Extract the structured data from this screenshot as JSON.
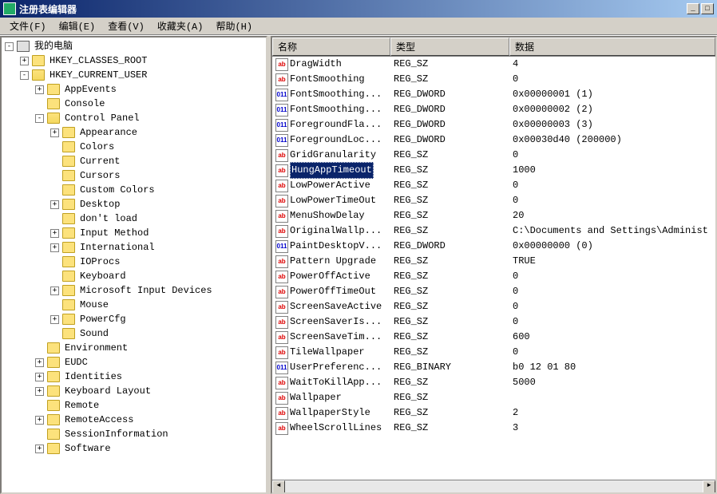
{
  "window_title": "注册表编辑器",
  "menu": {
    "file": "文件(F)",
    "edit": "编辑(E)",
    "view": "查看(V)",
    "favorites": "收藏夹(A)",
    "help": "帮助(H)"
  },
  "columns": {
    "name": "名称",
    "type": "类型",
    "data": "数据"
  },
  "tree": [
    {
      "indent": 0,
      "exp": "-",
      "icon": "computer",
      "label": "我的电脑"
    },
    {
      "indent": 1,
      "exp": "+",
      "icon": "folder",
      "label": "HKEY_CLASSES_ROOT"
    },
    {
      "indent": 1,
      "exp": "-",
      "icon": "folder-open",
      "label": "HKEY_CURRENT_USER"
    },
    {
      "indent": 2,
      "exp": "+",
      "icon": "folder",
      "label": "AppEvents"
    },
    {
      "indent": 2,
      "exp": "",
      "icon": "folder",
      "label": "Console"
    },
    {
      "indent": 2,
      "exp": "-",
      "icon": "folder-open",
      "label": "Control Panel"
    },
    {
      "indent": 3,
      "exp": "+",
      "icon": "folder",
      "label": "Appearance"
    },
    {
      "indent": 3,
      "exp": "",
      "icon": "folder",
      "label": "Colors"
    },
    {
      "indent": 3,
      "exp": "",
      "icon": "folder",
      "label": "Current"
    },
    {
      "indent": 3,
      "exp": "",
      "icon": "folder",
      "label": "Cursors"
    },
    {
      "indent": 3,
      "exp": "",
      "icon": "folder",
      "label": "Custom Colors"
    },
    {
      "indent": 3,
      "exp": "+",
      "icon": "folder",
      "label": "Desktop"
    },
    {
      "indent": 3,
      "exp": "",
      "icon": "folder",
      "label": "don't load"
    },
    {
      "indent": 3,
      "exp": "+",
      "icon": "folder",
      "label": "Input Method"
    },
    {
      "indent": 3,
      "exp": "+",
      "icon": "folder",
      "label": "International"
    },
    {
      "indent": 3,
      "exp": "",
      "icon": "folder",
      "label": "IOProcs"
    },
    {
      "indent": 3,
      "exp": "",
      "icon": "folder",
      "label": "Keyboard"
    },
    {
      "indent": 3,
      "exp": "+",
      "icon": "folder",
      "label": "Microsoft Input Devices"
    },
    {
      "indent": 3,
      "exp": "",
      "icon": "folder",
      "label": "Mouse"
    },
    {
      "indent": 3,
      "exp": "+",
      "icon": "folder",
      "label": "PowerCfg"
    },
    {
      "indent": 3,
      "exp": "",
      "icon": "folder",
      "label": "Sound"
    },
    {
      "indent": 2,
      "exp": "",
      "icon": "folder",
      "label": "Environment"
    },
    {
      "indent": 2,
      "exp": "+",
      "icon": "folder",
      "label": "EUDC"
    },
    {
      "indent": 2,
      "exp": "+",
      "icon": "folder",
      "label": "Identities"
    },
    {
      "indent": 2,
      "exp": "+",
      "icon": "folder",
      "label": "Keyboard Layout"
    },
    {
      "indent": 2,
      "exp": "",
      "icon": "folder",
      "label": "Remote"
    },
    {
      "indent": 2,
      "exp": "+",
      "icon": "folder",
      "label": "RemoteAccess"
    },
    {
      "indent": 2,
      "exp": "",
      "icon": "folder",
      "label": "SessionInformation"
    },
    {
      "indent": 2,
      "exp": "+",
      "icon": "folder",
      "label": "Software"
    }
  ],
  "values": [
    {
      "icon": "sz",
      "name": "DragWidth",
      "type": "REG_SZ",
      "data": "4",
      "selected": false
    },
    {
      "icon": "sz",
      "name": "FontSmoothing",
      "type": "REG_SZ",
      "data": "0",
      "selected": false
    },
    {
      "icon": "dw",
      "name": "FontSmoothing...",
      "type": "REG_DWORD",
      "data": "0x00000001 (1)",
      "selected": false
    },
    {
      "icon": "dw",
      "name": "FontSmoothing...",
      "type": "REG_DWORD",
      "data": "0x00000002 (2)",
      "selected": false
    },
    {
      "icon": "dw",
      "name": "ForegroundFla...",
      "type": "REG_DWORD",
      "data": "0x00000003 (3)",
      "selected": false
    },
    {
      "icon": "dw",
      "name": "ForegroundLoc...",
      "type": "REG_DWORD",
      "data": "0x00030d40 (200000)",
      "selected": false
    },
    {
      "icon": "sz",
      "name": "GridGranularity",
      "type": "REG_SZ",
      "data": "0",
      "selected": false
    },
    {
      "icon": "sz",
      "name": "HungAppTimeout",
      "type": "REG_SZ",
      "data": "1000",
      "selected": true
    },
    {
      "icon": "sz",
      "name": "LowPowerActive",
      "type": "REG_SZ",
      "data": "0",
      "selected": false
    },
    {
      "icon": "sz",
      "name": "LowPowerTimeOut",
      "type": "REG_SZ",
      "data": "0",
      "selected": false
    },
    {
      "icon": "sz",
      "name": "MenuShowDelay",
      "type": "REG_SZ",
      "data": "20",
      "selected": false
    },
    {
      "icon": "sz",
      "name": "OriginalWallp...",
      "type": "REG_SZ",
      "data": "C:\\Documents and Settings\\Administ",
      "selected": false
    },
    {
      "icon": "dw",
      "name": "PaintDesktopV...",
      "type": "REG_DWORD",
      "data": "0x00000000 (0)",
      "selected": false
    },
    {
      "icon": "sz",
      "name": "Pattern Upgrade",
      "type": "REG_SZ",
      "data": "TRUE",
      "selected": false
    },
    {
      "icon": "sz",
      "name": "PowerOffActive",
      "type": "REG_SZ",
      "data": "0",
      "selected": false
    },
    {
      "icon": "sz",
      "name": "PowerOffTimeOut",
      "type": "REG_SZ",
      "data": "0",
      "selected": false
    },
    {
      "icon": "sz",
      "name": "ScreenSaveActive",
      "type": "REG_SZ",
      "data": "0",
      "selected": false
    },
    {
      "icon": "sz",
      "name": "ScreenSaverIs...",
      "type": "REG_SZ",
      "data": "0",
      "selected": false
    },
    {
      "icon": "sz",
      "name": "ScreenSaveTim...",
      "type": "REG_SZ",
      "data": "600",
      "selected": false
    },
    {
      "icon": "sz",
      "name": "TileWallpaper",
      "type": "REG_SZ",
      "data": "0",
      "selected": false
    },
    {
      "icon": "dw",
      "name": "UserPreferenc...",
      "type": "REG_BINARY",
      "data": "b0 12 01 80",
      "selected": false
    },
    {
      "icon": "sz",
      "name": "WaitToKillApp...",
      "type": "REG_SZ",
      "data": "5000",
      "selected": false
    },
    {
      "icon": "sz",
      "name": "Wallpaper",
      "type": "REG_SZ",
      "data": "",
      "selected": false
    },
    {
      "icon": "sz",
      "name": "WallpaperStyle",
      "type": "REG_SZ",
      "data": "2",
      "selected": false
    },
    {
      "icon": "sz",
      "name": "WheelScrollLines",
      "type": "REG_SZ",
      "data": "3",
      "selected": false
    }
  ]
}
